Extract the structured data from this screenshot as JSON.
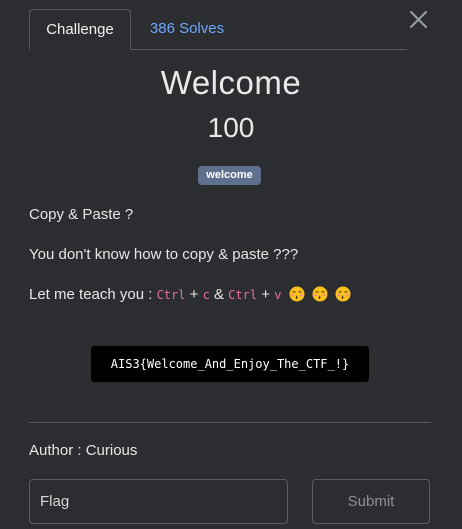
{
  "tabs": {
    "challenge_label": "Challenge",
    "solves_label": "386 Solves"
  },
  "challenge": {
    "name": "Welcome",
    "points": "100",
    "tag": "welcome",
    "description": {
      "line1": "Copy & Paste ?",
      "line2": "You don't know how to copy & paste ???",
      "line3_prefix": "Let me teach you : ",
      "ctrl1": "Ctrl",
      "plus1": " + ",
      "key1": "c",
      "amp": " & ",
      "ctrl2": "Ctrl",
      "plus2": " + ",
      "key2": "v"
    },
    "flag_text": "AIS3{Welcome_And_Enjoy_The_CTF_!}",
    "author": "Author : Curious"
  },
  "form": {
    "flag_placeholder": "Flag",
    "submit_label": "Submit"
  },
  "icons": {
    "close": "close-icon",
    "emoji": "kissing-face-emoji"
  },
  "colors": {
    "background": "#2b2d31",
    "link": "#6ea8fe",
    "tag_bg": "#5e708d",
    "inline_code": "#e66fa0"
  }
}
